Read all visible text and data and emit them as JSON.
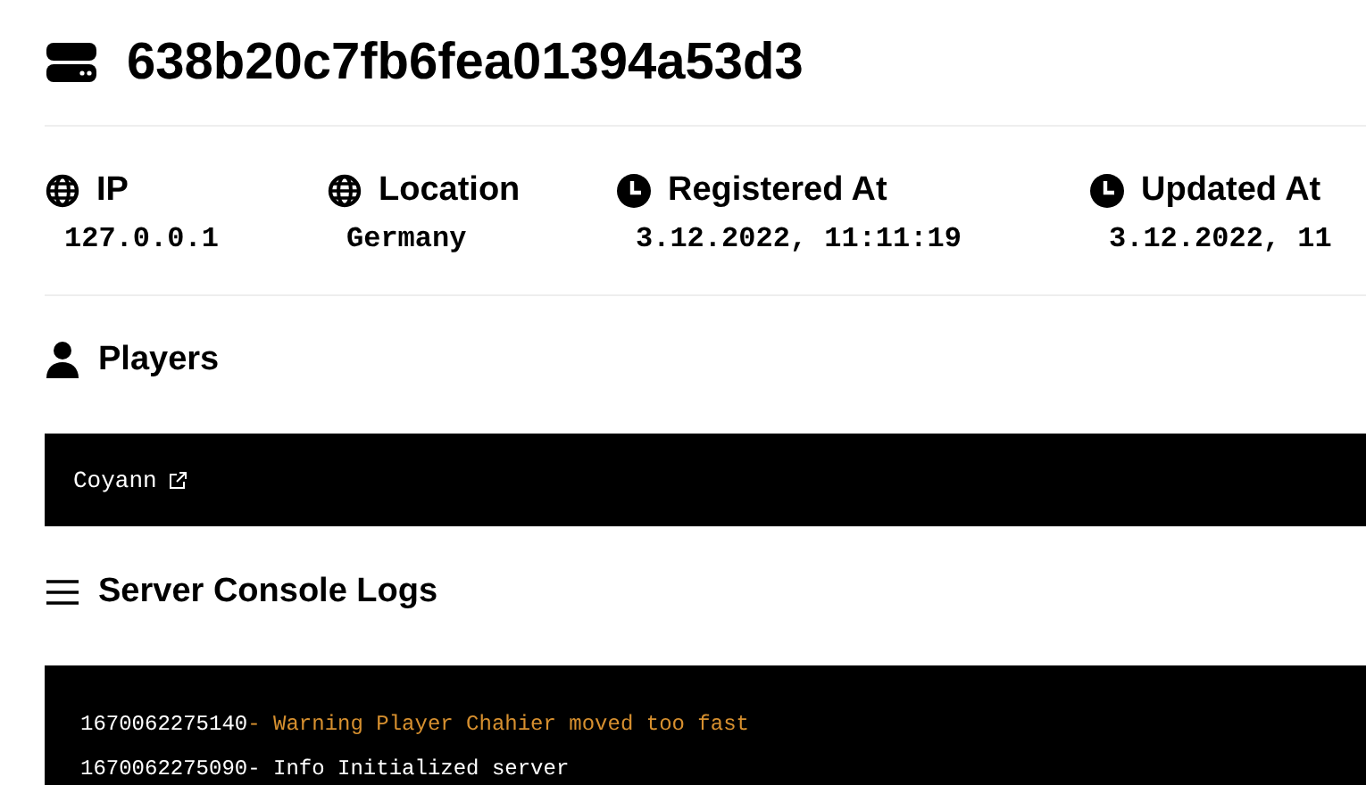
{
  "server": {
    "id": "638b20c7fb6fea01394a53d3"
  },
  "stats": [
    {
      "kind": "globe",
      "label": "IP",
      "value": "127.0.0.1"
    },
    {
      "kind": "globe",
      "label": "Location",
      "value": "Germany"
    },
    {
      "kind": "clock",
      "label": "Registered At",
      "value": "3.12.2022, 11:11:19"
    },
    {
      "kind": "clock",
      "label": "Updated At",
      "value": "3.12.2022, 11"
    }
  ],
  "players": {
    "title": "Players",
    "items": [
      {
        "name": "Coyann"
      }
    ]
  },
  "logs": {
    "title": "Server Console Logs",
    "lines": [
      {
        "kind": "warning",
        "time": "1670062275140",
        "message": "- Warning Player Chahier moved too fast"
      },
      {
        "kind": "info",
        "time": "1670062275090",
        "message": "- Info Initialized server"
      }
    ]
  }
}
